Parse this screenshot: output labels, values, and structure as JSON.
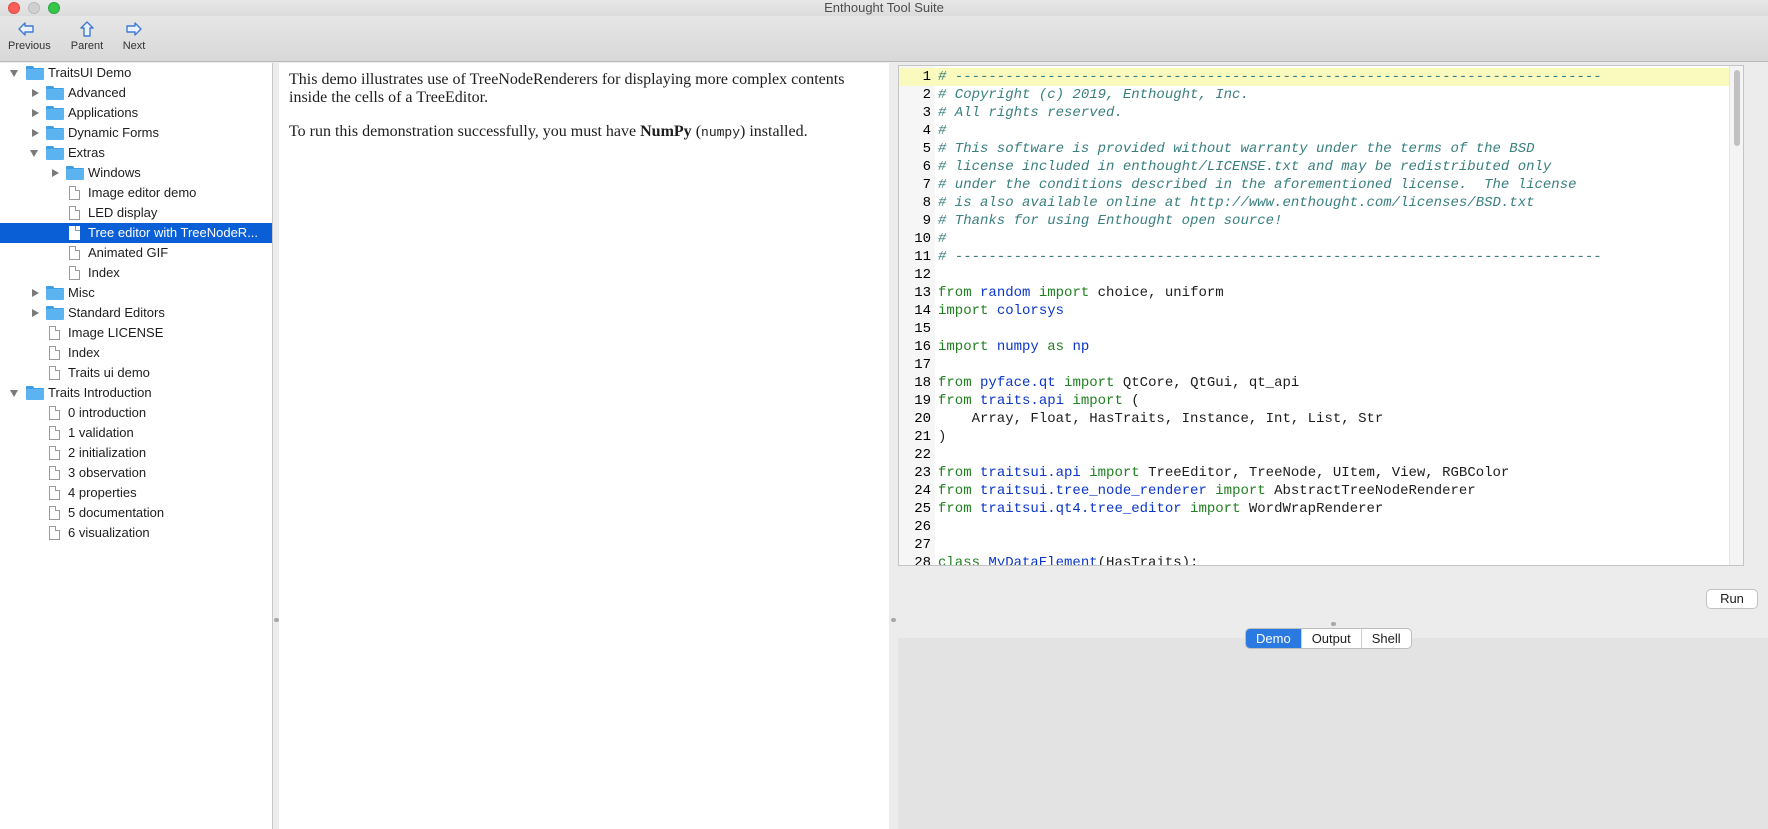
{
  "window": {
    "title": "Enthought Tool Suite"
  },
  "toolbar": {
    "previous_label": "Previous",
    "parent_label": "Parent",
    "next_label": "Next"
  },
  "tree": [
    {
      "label": "TraitsUI Demo",
      "type": "folder",
      "expanded": true,
      "depth": 0
    },
    {
      "label": "Advanced",
      "type": "folder",
      "expanded": false,
      "depth": 1
    },
    {
      "label": "Applications",
      "type": "folder",
      "expanded": false,
      "depth": 1
    },
    {
      "label": "Dynamic Forms",
      "type": "folder",
      "expanded": false,
      "depth": 1
    },
    {
      "label": "Extras",
      "type": "folder",
      "expanded": true,
      "depth": 1
    },
    {
      "label": "Windows",
      "type": "folder",
      "expanded": false,
      "depth": 2
    },
    {
      "label": "Image editor demo",
      "type": "file",
      "depth": 2
    },
    {
      "label": "LED display",
      "type": "file",
      "depth": 2
    },
    {
      "label": "Tree editor with TreeNodeR...",
      "type": "file",
      "depth": 2,
      "selected": true
    },
    {
      "label": "Animated GIF",
      "type": "file",
      "depth": 2
    },
    {
      "label": "Index",
      "type": "file",
      "depth": 2
    },
    {
      "label": "Misc",
      "type": "folder",
      "expanded": false,
      "depth": 1
    },
    {
      "label": "Standard Editors",
      "type": "folder",
      "expanded": false,
      "depth": 1
    },
    {
      "label": "Image LICENSE",
      "type": "file",
      "depth": 1
    },
    {
      "label": "Index",
      "type": "file",
      "depth": 1
    },
    {
      "label": "Traits ui demo",
      "type": "file",
      "depth": 1
    },
    {
      "label": "Traits Introduction",
      "type": "folder",
      "expanded": true,
      "depth": 0
    },
    {
      "label": "0 introduction",
      "type": "file",
      "depth": 1
    },
    {
      "label": "1 validation",
      "type": "file",
      "depth": 1
    },
    {
      "label": "2 initialization",
      "type": "file",
      "depth": 1
    },
    {
      "label": "3 observation",
      "type": "file",
      "depth": 1
    },
    {
      "label": "4 properties",
      "type": "file",
      "depth": 1
    },
    {
      "label": "5 documentation",
      "type": "file",
      "depth": 1
    },
    {
      "label": "6 visualization",
      "type": "file",
      "depth": 1
    }
  ],
  "description": {
    "para1": "This demo illustrates use of TreeNodeRenderers for displaying more complex contents inside the cells of a TreeEditor.",
    "para2_prefix": "To run this demonstration successfully, you must have ",
    "para2_bold": "NumPy",
    "para2_code": "numpy",
    "para2_suffix": " installed."
  },
  "code_lines": [
    [
      [
        "cm",
        "# -----------------------------------------------------------------------------"
      ]
    ],
    [
      [
        "cm",
        "# Copyright (c) 2019, Enthought, Inc."
      ]
    ],
    [
      [
        "cm",
        "# All rights reserved."
      ]
    ],
    [
      [
        "cm",
        "#"
      ]
    ],
    [
      [
        "cm",
        "# This software is provided without warranty under the terms of the BSD"
      ]
    ],
    [
      [
        "cm",
        "# license included in enthought/LICENSE.txt and may be redistributed only"
      ]
    ],
    [
      [
        "cm",
        "# under the conditions described in the aforementioned license.  The license"
      ]
    ],
    [
      [
        "cm",
        "# is also available online at http://www.enthought.com/licenses/BSD.txt"
      ]
    ],
    [
      [
        "cm",
        "# Thanks for using Enthought open source!"
      ]
    ],
    [
      [
        "cm",
        "#"
      ]
    ],
    [
      [
        "cm",
        "# -----------------------------------------------------------------------------"
      ]
    ],
    [],
    [
      [
        "kw",
        "from "
      ],
      [
        "mod",
        "random"
      ],
      [
        "kw",
        " import "
      ],
      [
        "",
        "choice, uniform"
      ]
    ],
    [
      [
        "kw",
        "import "
      ],
      [
        "mod",
        "colorsys"
      ]
    ],
    [],
    [
      [
        "kw",
        "import "
      ],
      [
        "mod",
        "numpy"
      ],
      [
        "kw",
        " as "
      ],
      [
        "mod",
        "np"
      ]
    ],
    [],
    [
      [
        "kw",
        "from "
      ],
      [
        "mod",
        "pyface.qt"
      ],
      [
        "kw",
        " import "
      ],
      [
        "",
        "QtCore, QtGui, qt_api"
      ]
    ],
    [
      [
        "kw",
        "from "
      ],
      [
        "mod",
        "traits.api"
      ],
      [
        "kw",
        " import "
      ],
      [
        "",
        "("
      ]
    ],
    [
      [
        "",
        "    Array, Float, HasTraits, Instance, Int, List, Str"
      ]
    ],
    [
      [
        "",
        ")"
      ]
    ],
    [],
    [
      [
        "kw",
        "from "
      ],
      [
        "mod",
        "traitsui.api"
      ],
      [
        "kw",
        " import "
      ],
      [
        "",
        "TreeEditor, TreeNode, UItem, View, RGBColor"
      ]
    ],
    [
      [
        "kw",
        "from "
      ],
      [
        "mod",
        "traitsui.tree_node_renderer"
      ],
      [
        "kw",
        " import "
      ],
      [
        "",
        "AbstractTreeNodeRenderer"
      ]
    ],
    [
      [
        "kw",
        "from "
      ],
      [
        "mod",
        "traitsui.qt4.tree_editor"
      ],
      [
        "kw",
        " import "
      ],
      [
        "",
        "WordWrapRenderer"
      ]
    ],
    [],
    [],
    [
      [
        "kw",
        "class "
      ],
      [
        "mod",
        "MyDataElement"
      ],
      [
        "",
        "(HasTraits):"
      ]
    ]
  ],
  "run_label": "Run",
  "tabs": [
    "Demo",
    "Output",
    "Shell"
  ],
  "active_tab": "Demo"
}
